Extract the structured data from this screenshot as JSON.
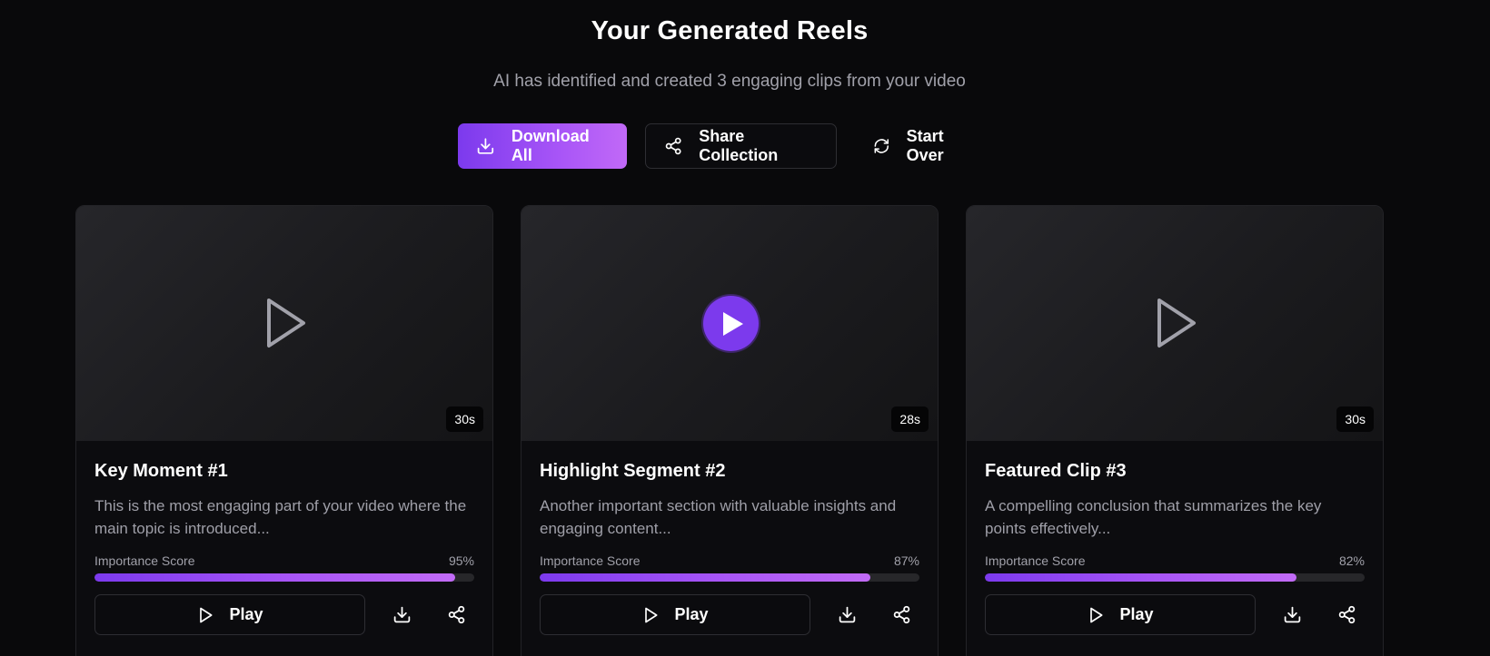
{
  "header": {
    "title": "Your Generated Reels",
    "subtitle": "AI has identified and created 3 engaging clips from your video"
  },
  "actions": {
    "download_all": "Download All",
    "share_collection": "Share Collection",
    "start_over": "Start Over"
  },
  "colors": {
    "accent": "#7c3aed",
    "accent_light": "#c169f7",
    "background": "#09090b"
  },
  "score_label": "Importance Score",
  "play_label": "Play",
  "clips": [
    {
      "title": "Key Moment #1",
      "description": "This is the most engaging part of your video where the main topic is introduced...",
      "duration": "30s",
      "score": 95,
      "score_text": "95%",
      "thumbnail_active": false
    },
    {
      "title": "Highlight Segment #2",
      "description": "Another important section with valuable insights and engaging content...",
      "duration": "28s",
      "score": 87,
      "score_text": "87%",
      "thumbnail_active": true
    },
    {
      "title": "Featured Clip #3",
      "description": "A compelling conclusion that summarizes the key points effectively...",
      "duration": "30s",
      "score": 82,
      "score_text": "82%",
      "thumbnail_active": false
    }
  ]
}
